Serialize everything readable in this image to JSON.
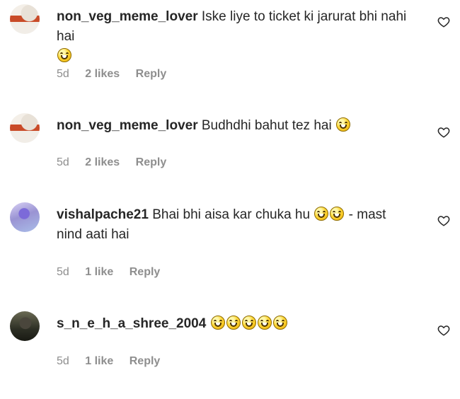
{
  "comments": [
    {
      "username": "non_veg_meme_lover",
      "text": "Iske liye to ticket ki jarurat bhi nahi hai",
      "emoji_count": 1,
      "age": "5d",
      "likes": "2 likes",
      "reply": "Reply",
      "avatar_icon": "user-avatar-icon",
      "like_icon": "heart-outline-icon"
    },
    {
      "username": "non_veg_meme_lover",
      "text": "Budhdhi bahut tez hai",
      "emoji_count": 1,
      "age": "5d",
      "likes": "2 likes",
      "reply": "Reply",
      "avatar_icon": "user-avatar-icon",
      "like_icon": "heart-outline-icon"
    },
    {
      "username": "vishalpache21",
      "text": "Bhai bhi aisa kar chuka hu",
      "text_after_emoji": "- mast nind aati hai",
      "emoji_count": 2,
      "age": "5d",
      "likes": "1 like",
      "reply": "Reply",
      "avatar_icon": "user-avatar-icon",
      "like_icon": "heart-outline-icon"
    },
    {
      "username": "s_n_e_h_a_shree_2004",
      "text": "",
      "emoji_count": 5,
      "age": "5d",
      "likes": "1 like",
      "reply": "Reply",
      "avatar_icon": "user-avatar-icon",
      "like_icon": "heart-outline-icon"
    }
  ],
  "colors": {
    "text": "#262626",
    "meta_text": "#8e8e8e",
    "background": "#ffffff"
  }
}
